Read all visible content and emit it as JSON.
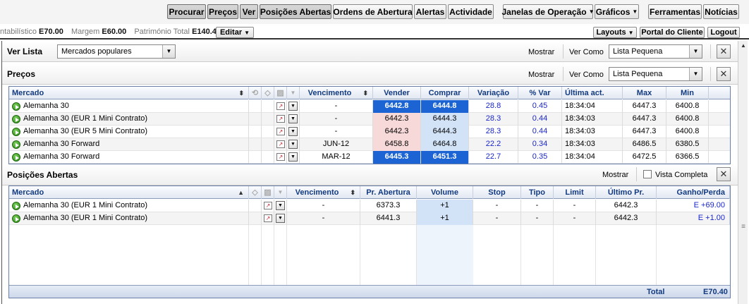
{
  "toolbar": {
    "buttons": [
      {
        "label": "Procurar"
      },
      {
        "label": "Preços"
      },
      {
        "label": "Ver"
      },
      {
        "label": "Posições Abertas"
      },
      {
        "label": "Ordens de Abertura"
      },
      {
        "label": "Alertas"
      },
      {
        "label": "Actividade"
      },
      {
        "label": "Janelas de Operação"
      },
      {
        "label": "Gráficos"
      },
      {
        "label": "Ferramentas"
      },
      {
        "label": "Notícias"
      }
    ]
  },
  "account": {
    "contabilistico_label": "ntabilístico",
    "contabilistico_value": "E70.00",
    "margem_label": "Margem",
    "margem_value": "E60.00",
    "patrimonio_label": "Património Total",
    "patrimonio_value": "E140.40",
    "editar_label": "Editar",
    "layouts_label": "Layouts",
    "portal_label": "Portal do Cliente",
    "logout_label": "Logout"
  },
  "verlista": {
    "title": "Ver Lista",
    "selected": "Mercados populares",
    "mostrar_label": "Mostrar",
    "vercomo_label": "Ver Como",
    "vercomo_value": "Lista Pequena",
    "close": "✕"
  },
  "precos": {
    "title": "Preços",
    "mostrar_label": "Mostrar",
    "vercomo_label": "Ver Como",
    "vercomo_value": "Lista Pequena",
    "close": "✕",
    "columns": {
      "mercado": "Mercado",
      "vencimento": "Vencimento",
      "vender": "Vender",
      "comprar": "Comprar",
      "variacao": "Variação",
      "pvar": "% Var",
      "ultima": "Última act.",
      "max": "Max",
      "min": "Min"
    },
    "rows": [
      {
        "mercado": "Alemanha 30",
        "vencimento": "-",
        "vender": "6442.8",
        "comprar": "6444.8",
        "variacao": "28.8",
        "pvar": "0.45",
        "ultima": "18:34:04",
        "max": "6447.3",
        "min": "6400.8",
        "hl": true
      },
      {
        "mercado": "Alemanha 30 (EUR 1 Mini Contrato)",
        "vencimento": "-",
        "vender": "6442.3",
        "comprar": "6444.3",
        "variacao": "28.3",
        "pvar": "0.44",
        "ultima": "18:34:03",
        "max": "6447.3",
        "min": "6400.8",
        "hl": false
      },
      {
        "mercado": "Alemanha 30 (EUR 5 Mini Contrato)",
        "vencimento": "-",
        "vender": "6442.3",
        "comprar": "6444.3",
        "variacao": "28.3",
        "pvar": "0.44",
        "ultima": "18:34:03",
        "max": "6447.3",
        "min": "6400.8",
        "hl": false
      },
      {
        "mercado": "Alemanha 30 Forward",
        "vencimento": "JUN-12",
        "vender": "6458.8",
        "comprar": "6464.8",
        "variacao": "22.2",
        "pvar": "0.34",
        "ultima": "18:34:03",
        "max": "6486.5",
        "min": "6380.5",
        "hl": false
      },
      {
        "mercado": "Alemanha 30 Forward",
        "vencimento": "MAR-12",
        "vender": "6445.3",
        "comprar": "6451.3",
        "variacao": "22.7",
        "pvar": "0.35",
        "ultima": "18:34:04",
        "max": "6472.5",
        "min": "6366.5",
        "hl": true
      }
    ]
  },
  "posicoes": {
    "title": "Posições Abertas",
    "mostrar_label": "Mostrar",
    "vista_label": "Vista Completa",
    "close": "✕",
    "columns": {
      "mercado": "Mercado",
      "vencimento": "Vencimento",
      "abertura": "Pr. Abertura",
      "volume": "Volume",
      "stop": "Stop",
      "tipo": "Tipo",
      "limit": "Limit",
      "ultimo": "Último Pr.",
      "ganho": "Ganho/Perda"
    },
    "rows": [
      {
        "mercado": "Alemanha 30 (EUR 1 Mini Contrato)",
        "vencimento": "-",
        "abertura": "6373.3",
        "volume": "+1",
        "stop": "-",
        "tipo": "-",
        "limit": "-",
        "ultimo": "6442.3",
        "ganho": "E +69.00"
      },
      {
        "mercado": "Alemanha 30 (EUR 1 Mini Contrato)",
        "vencimento": "-",
        "abertura": "6441.3",
        "volume": "+1",
        "stop": "-",
        "tipo": "-",
        "limit": "-",
        "ultimo": "6442.3",
        "ganho": "E +1.00"
      }
    ],
    "total_label": "Total",
    "total_value": "E70.40"
  }
}
